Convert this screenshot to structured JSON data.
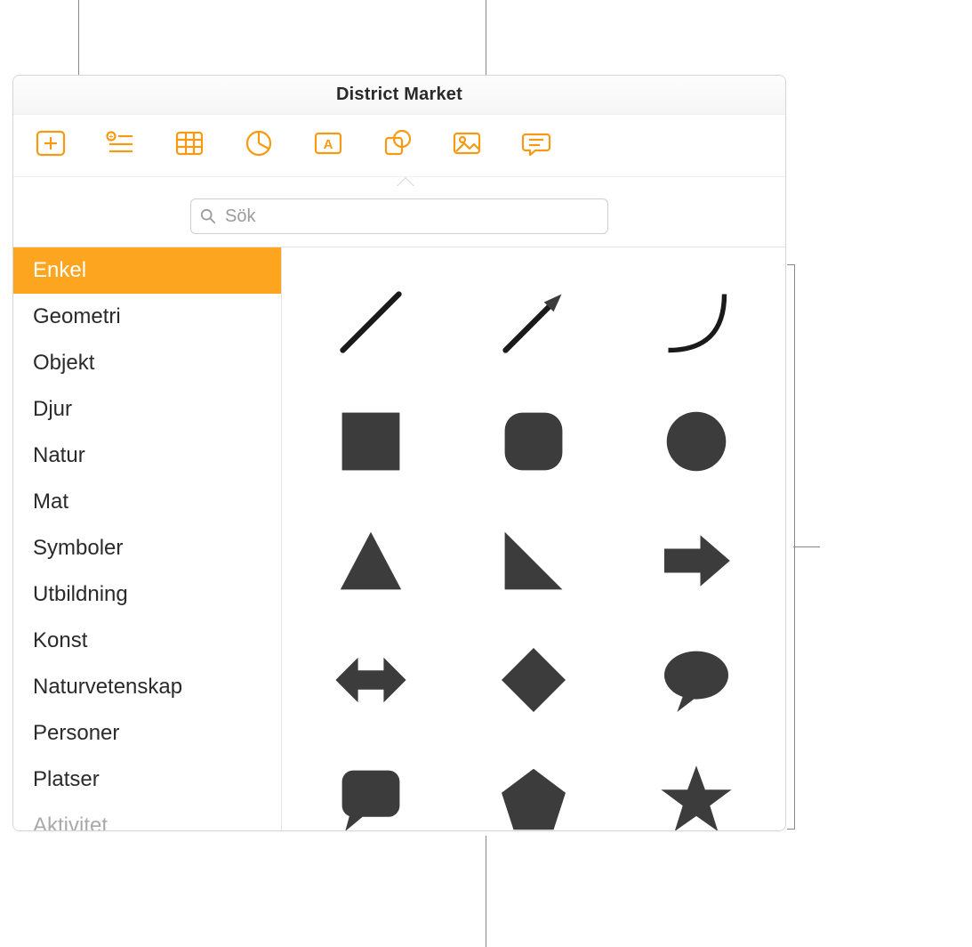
{
  "window": {
    "title": "District Market"
  },
  "search": {
    "placeholder": "Sök"
  },
  "categories": {
    "items": [
      {
        "label": "Enkel",
        "selected": true
      },
      {
        "label": "Geometri"
      },
      {
        "label": "Objekt"
      },
      {
        "label": "Djur"
      },
      {
        "label": "Natur"
      },
      {
        "label": "Mat"
      },
      {
        "label": "Symboler"
      },
      {
        "label": "Utbildning"
      },
      {
        "label": "Konst"
      },
      {
        "label": "Naturvetenskap"
      },
      {
        "label": "Personer"
      },
      {
        "label": "Platser"
      },
      {
        "label": "Aktivitet"
      }
    ]
  },
  "shapes": {
    "row1": [
      "line",
      "arrow",
      "curve"
    ],
    "row2": [
      "square",
      "rounded-square",
      "circle"
    ],
    "row3": [
      "triangle",
      "right-triangle",
      "arrow-right-block"
    ],
    "row4": [
      "double-arrow",
      "diamond",
      "speech-oval"
    ],
    "row5": [
      "speech-rect",
      "pentagon",
      "star"
    ]
  },
  "toolbar": {
    "items": [
      {
        "name": "add",
        "icon": "plus-icon"
      },
      {
        "name": "lists",
        "icon": "list-icon"
      },
      {
        "name": "table",
        "icon": "table-icon"
      },
      {
        "name": "chart",
        "icon": "chart-icon"
      },
      {
        "name": "textbox",
        "icon": "textbox-icon"
      },
      {
        "name": "shape",
        "icon": "shape-icon"
      },
      {
        "name": "media",
        "icon": "media-icon"
      },
      {
        "name": "comment",
        "icon": "comment-icon"
      }
    ]
  }
}
